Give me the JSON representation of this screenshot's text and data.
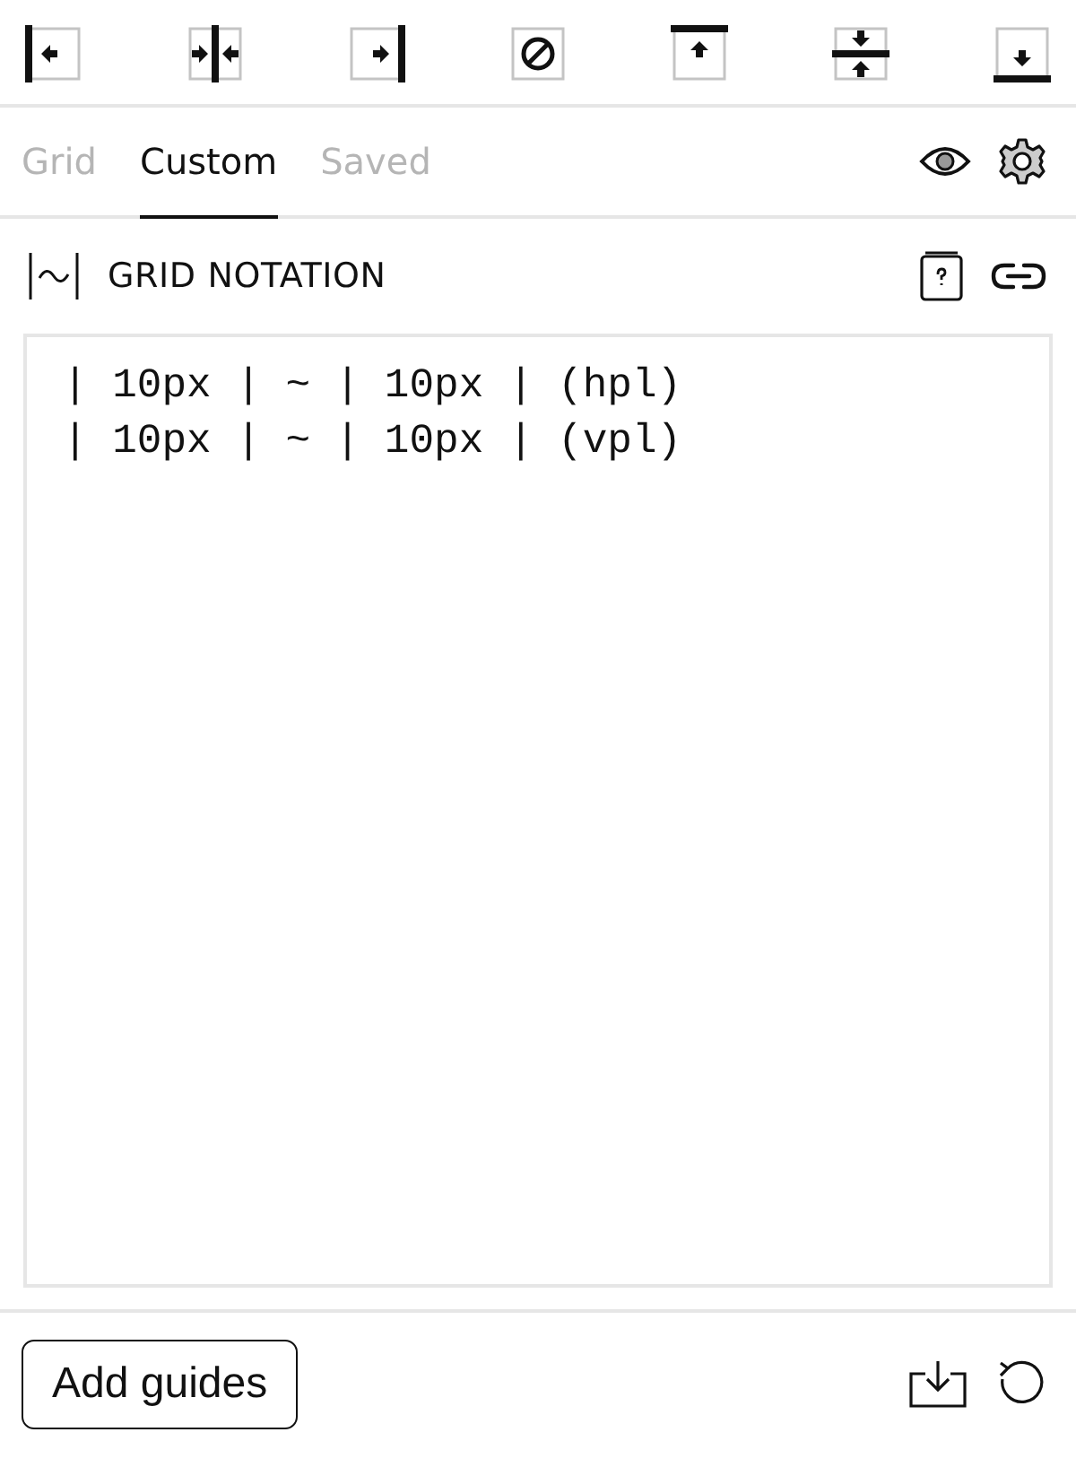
{
  "toolbar": [
    {
      "kind": "left"
    },
    {
      "kind": "center-v"
    },
    {
      "kind": "right"
    },
    {
      "kind": "none"
    },
    {
      "kind": "top"
    },
    {
      "kind": "center-h"
    },
    {
      "kind": "bottom"
    }
  ],
  "tabs": [
    {
      "label": "Grid",
      "selected": false
    },
    {
      "label": "Custom",
      "selected": true
    },
    {
      "label": "Saved",
      "selected": false
    }
  ],
  "section": {
    "title": "GRID NOTATION"
  },
  "notation": {
    "value": "| 10px | ~ | 10px | (hpl)\n| 10px | ~ | 10px | (vpl)"
  },
  "footer": {
    "button": "Add guides"
  }
}
